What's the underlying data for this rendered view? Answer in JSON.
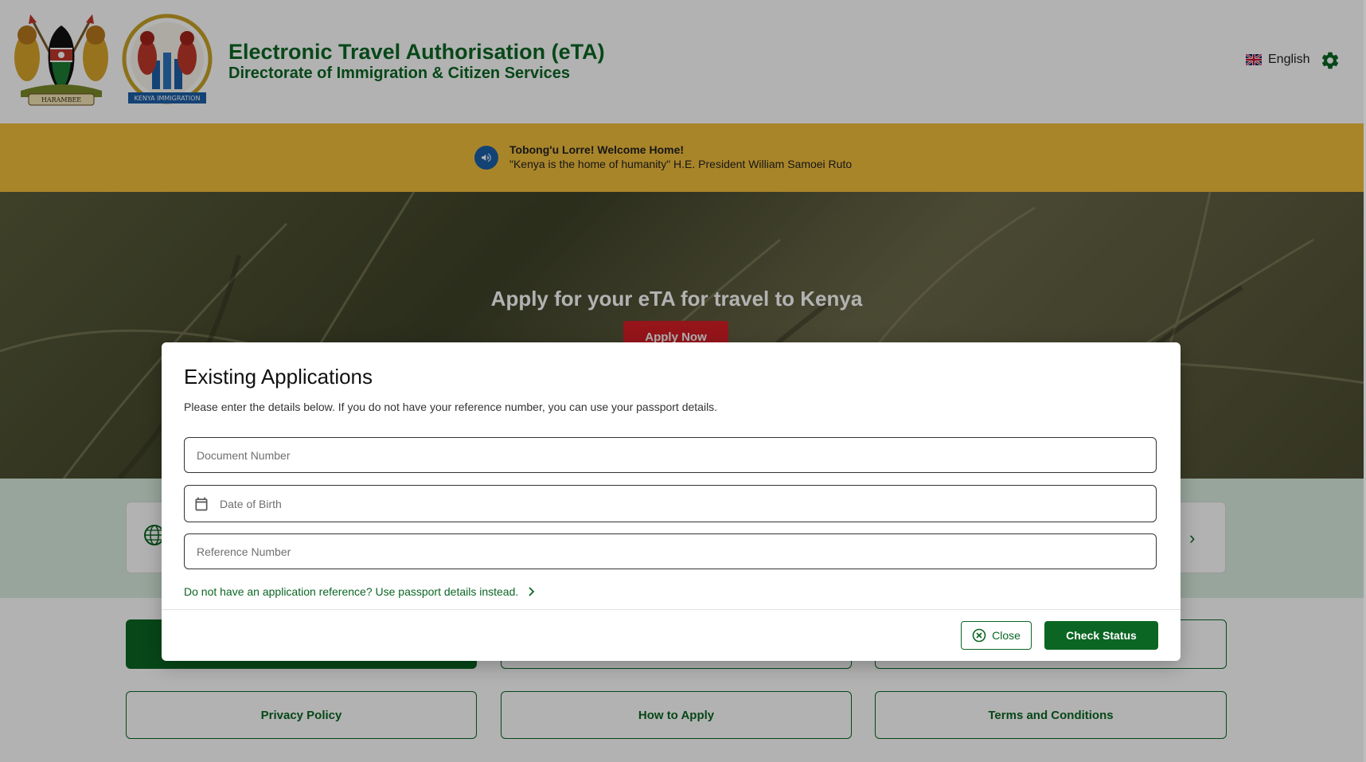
{
  "header": {
    "title": "Electronic Travel Authorisation (eTA)",
    "subtitle": "Directorate of Immigration & Citizen Services",
    "coat_of_arms_motto": "HARAMBEE",
    "seal_text": "KENYA IMMIGRATION",
    "language": "English"
  },
  "announcement": {
    "title": "Tobong'u Lorre! Welcome Home!",
    "text": "\"Kenya is the home of humanity\" H.E. President William Samoei Ruto"
  },
  "hero": {
    "title": "Apply for your eTA for travel to Kenya",
    "apply_label": "Apply Now"
  },
  "links": {
    "privacy": "Privacy Policy",
    "how_to_apply": "How to Apply",
    "terms": "Terms and Conditions"
  },
  "modal": {
    "title": "Existing Applications",
    "description": "Please enter the details below. If you do not have your reference number, you can use your passport details.",
    "fields": {
      "document_number": {
        "placeholder": "Document Number",
        "value": ""
      },
      "date_of_birth": {
        "placeholder": "Date of Birth",
        "value": ""
      },
      "reference_number": {
        "placeholder": "Reference Number",
        "value": ""
      }
    },
    "passport_link": "Do not have an application reference? Use passport details instead.",
    "close_label": "Close",
    "check_status_label": "Check Status"
  },
  "colors": {
    "brand_green": "#0b6623",
    "announcement_yellow": "#f2bf3d",
    "apply_red": "#d61f26",
    "megaphone_blue": "#1c5fa8"
  },
  "icons": [
    "coat-of-arms",
    "immigration-seal",
    "uk-flag-icon",
    "gear-icon",
    "megaphone-icon",
    "globe-icon",
    "chevron-right-icon",
    "calendar-icon",
    "close-circle-icon"
  ]
}
